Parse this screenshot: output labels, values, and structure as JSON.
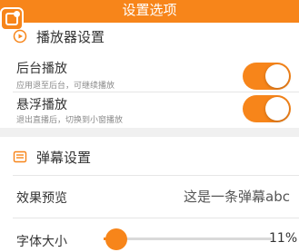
{
  "header": {
    "title": "设置选项"
  },
  "player": {
    "title": "播放器设置",
    "icon": "player-settings-icon",
    "items": [
      {
        "label": "后台播放",
        "desc": "应用退至后台，可继续播放",
        "enabled": true
      },
      {
        "label": "悬浮播放",
        "desc": "退出直播后，切换到小窗播放",
        "enabled": true
      }
    ]
  },
  "danmaku": {
    "title": "弹幕设置",
    "icon": "danmaku-icon",
    "preview_label": "效果预览",
    "preview_text": "这是一条弹幕abc",
    "font_label": "字体大小",
    "font_value": "11%",
    "font_level": 0.11
  },
  "colors": {
    "accent": "#f7851a",
    "divider": "#f0f0f0"
  }
}
